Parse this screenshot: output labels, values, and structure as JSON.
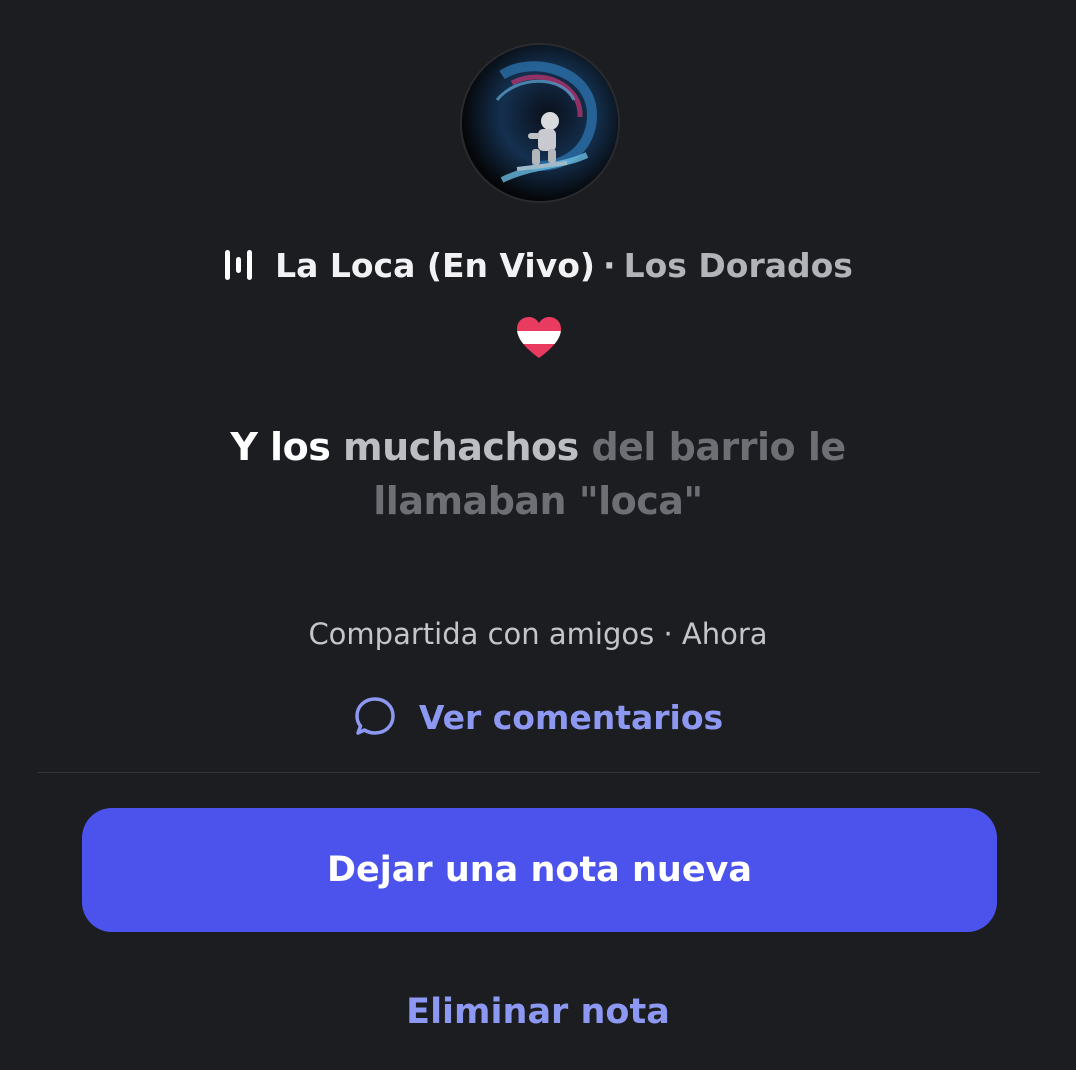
{
  "note": {
    "song_title": "La Loca (En Vivo)",
    "separator": "·",
    "artist": "Los Dorados",
    "lyrics": {
      "sung": "Y los ",
      "current": "muchachos",
      "upcoming_line1": " del barrio le",
      "upcoming_line2": "llamaban \"loca\""
    },
    "shared_text": "Compartida con amigos · Ahora",
    "comments_label": "Ver comentarios"
  },
  "actions": {
    "new_note_label": "Dejar una nota nueva",
    "delete_note_label": "Eliminar nota"
  },
  "icons": {
    "playing": "audio-bars-icon",
    "reaction": "heart-icon",
    "comments": "speech-bubble-icon"
  },
  "colors": {
    "background": "#1c1d20",
    "accent_button": "#4c53ec",
    "link": "#8c98f2"
  }
}
